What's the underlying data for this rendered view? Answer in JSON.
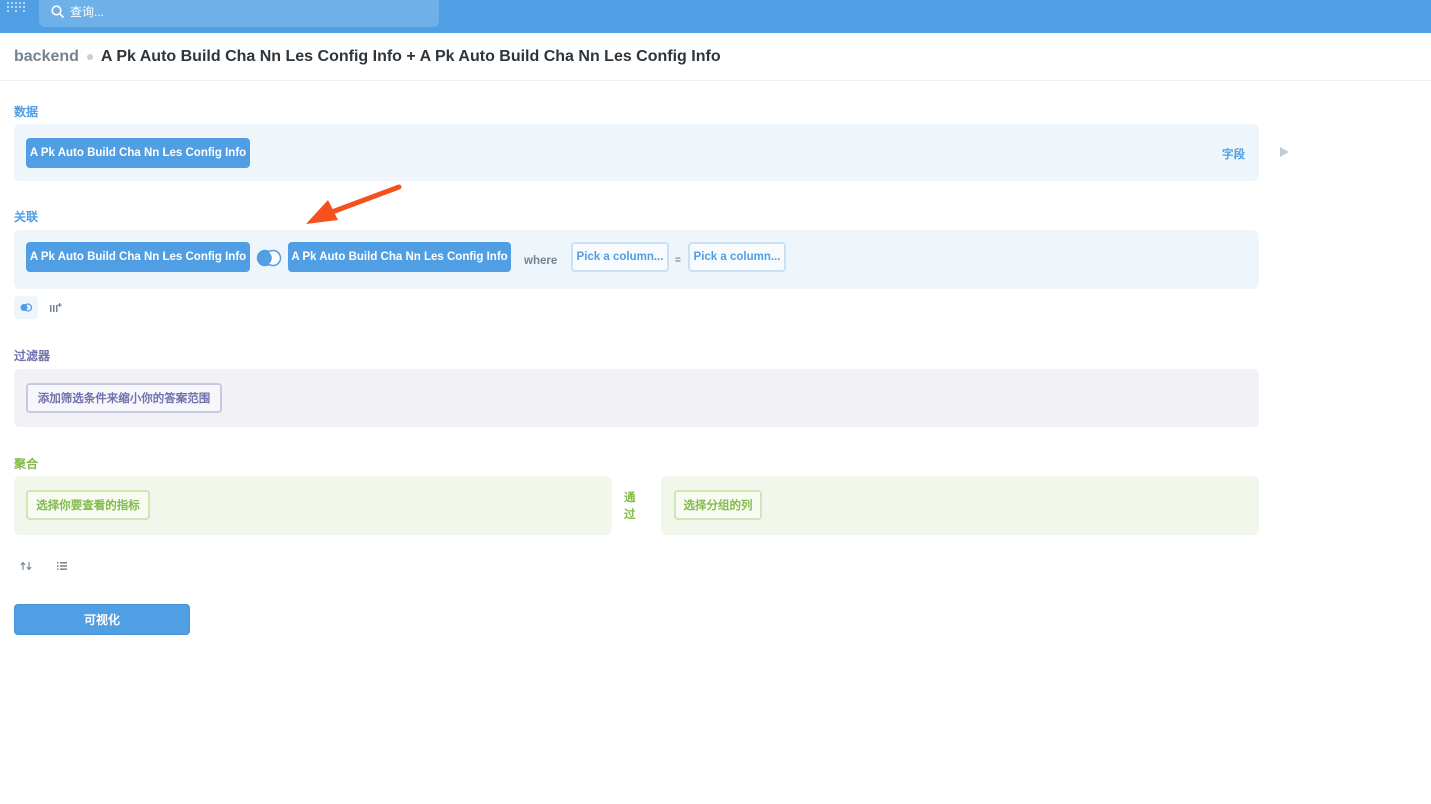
{
  "topbar": {
    "search_placeholder": "查询..."
  },
  "header": {
    "database": "backend",
    "title": "A Pk Auto Build Cha Nn Les Config Info + A Pk Auto Build Cha Nn Les Config Info"
  },
  "data_section": {
    "label": "数据",
    "table": "A Pk Auto Build Cha Nn Les Config Info",
    "fields_link": "字段"
  },
  "join_section": {
    "label": "关联",
    "left_table": "A Pk Auto Build Cha Nn Les Config Info",
    "right_table": "A Pk Auto Build Cha Nn Les Config Info",
    "where": "where",
    "left_column_placeholder": "Pick a column...",
    "equals": "=",
    "right_column_placeholder": "Pick a column..."
  },
  "filter_section": {
    "label": "过滤器",
    "add_filter": "添加筛选条件来缩小你的答案范围"
  },
  "summarize_section": {
    "label": "聚合",
    "metric_button": "选择你要查看的指标",
    "by_label": "通过",
    "group_button": "选择分组的列"
  },
  "visualize_button": "可视化",
  "colors": {
    "brand": "#509ee3",
    "filter": "#7172ad",
    "summarize": "#84bb4c",
    "annotation_arrow": "#f4511e"
  },
  "icons": {
    "logo": "metabase-logo-icon",
    "search": "search-icon",
    "run": "play-icon",
    "join_type": "venn-inner-join-icon",
    "join_action": "join-icon",
    "custom_column": "add-column-icon",
    "sort": "sort-icon",
    "limit": "list-icon"
  }
}
